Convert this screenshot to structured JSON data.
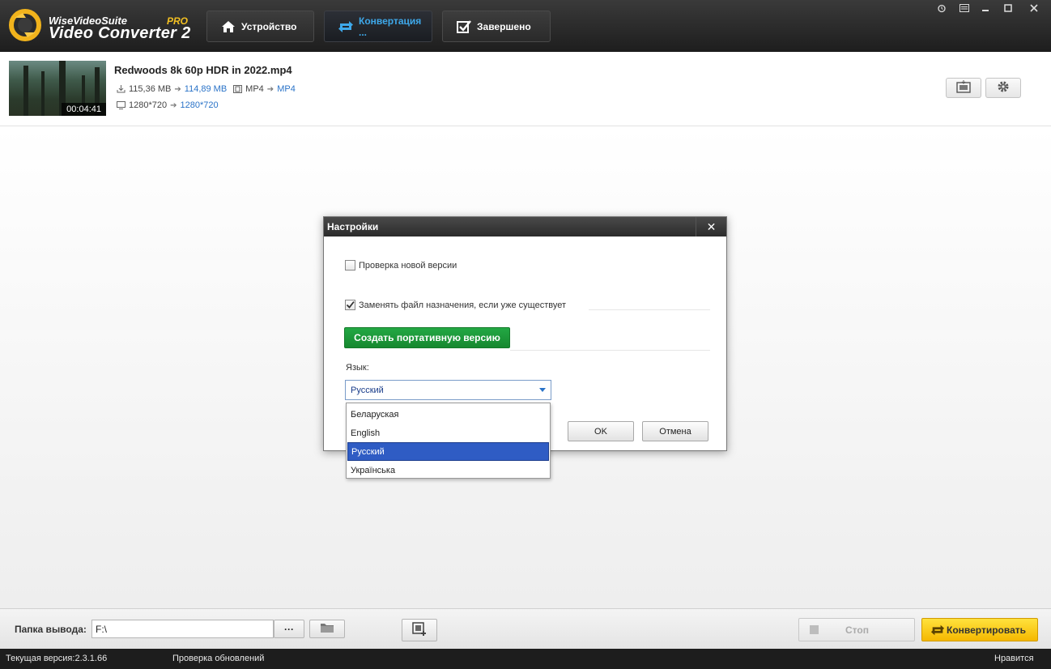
{
  "app": {
    "brand_top": "WiseVideoSuite",
    "brand_pro": "PRO",
    "brand_main": "Video Converter 2",
    "accent_color": "#3ea8ea"
  },
  "tabs": [
    {
      "label": "Устройство",
      "icon": "home-icon"
    },
    {
      "label": "Конвертация ...",
      "icon": "convert-icon",
      "active": true
    },
    {
      "label": "Завершено",
      "icon": "checkbox-icon"
    }
  ],
  "window_controls": [
    "alarm-icon",
    "menu-icon",
    "minimize-icon",
    "maximize-icon",
    "close-icon"
  ],
  "file": {
    "name": "Redwoods 8k 60p HDR in 2022.mp4",
    "duration": "00:04:41",
    "size_from": "115,36 MB",
    "size_to": "114,89 MB",
    "format_from": "MP4",
    "format_to": "MP4",
    "res_from": "1280*720",
    "res_to": "1280*720"
  },
  "dialog": {
    "title": "Настройки",
    "check_update_label": "Проверка новой версии",
    "check_update_checked": false,
    "replace_label": "Заменять файл назначения, если уже существует",
    "replace_checked": true,
    "portable_button": "Создать портативную версию",
    "language_label": "Язык:",
    "language_selected": "Русский",
    "ok_label": "OK",
    "cancel_label": "Отмена"
  },
  "language_options": [
    "Беларуская",
    "English",
    "Русский",
    "Українська"
  ],
  "bottom": {
    "output_label": "Папка вывода:",
    "output_value": "F:\\",
    "browse_label": "···",
    "stop_label": "Стоп",
    "convert_label": "Конвертировать"
  },
  "status": {
    "version": "Текущая версия:2.3.1.66",
    "check_updates": "Проверка обновлений",
    "like": "Нравится"
  }
}
